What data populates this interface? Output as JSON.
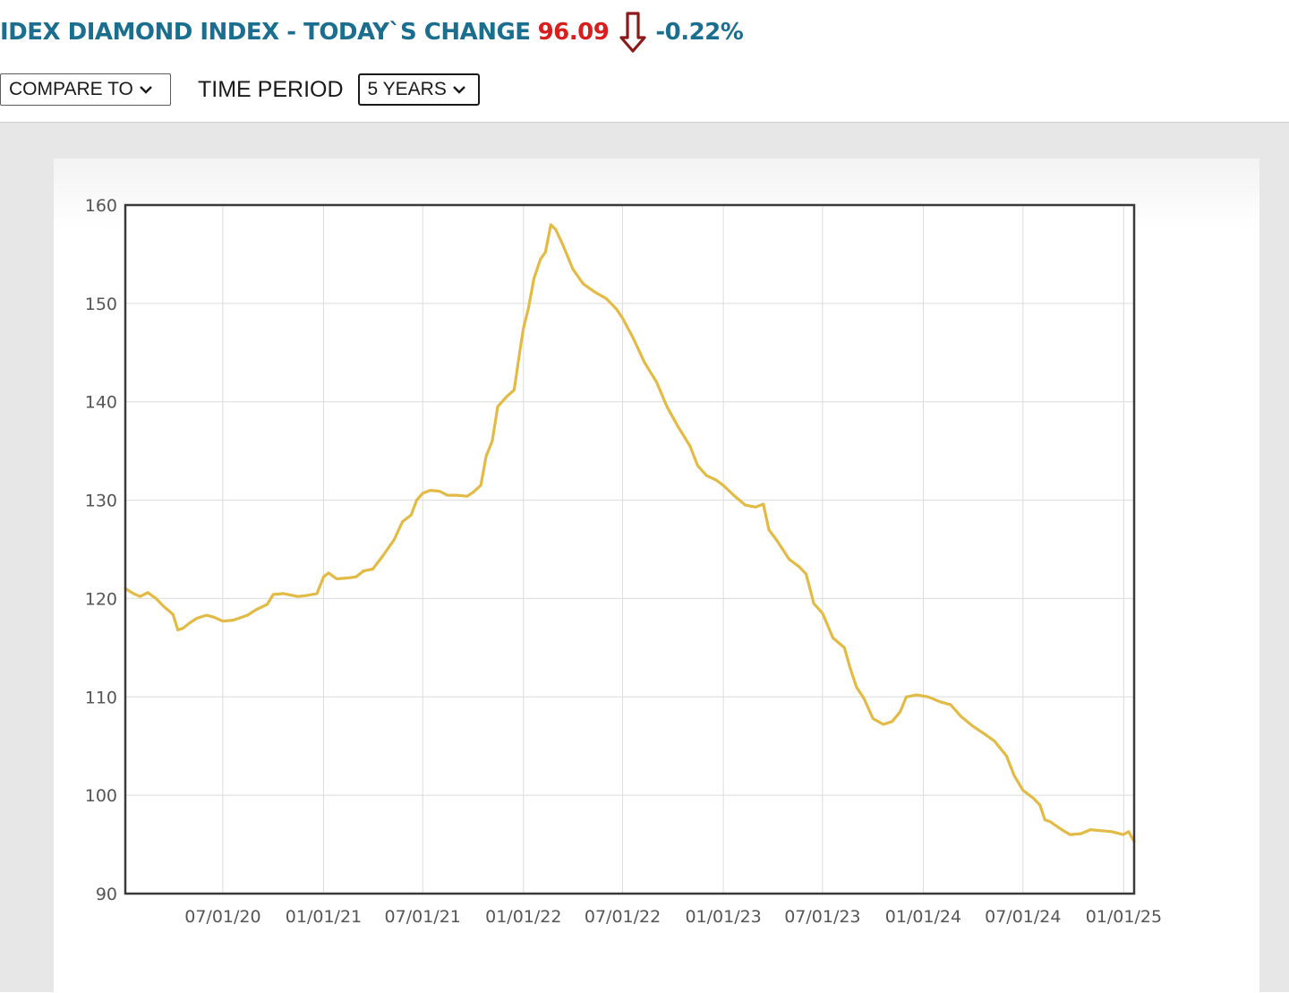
{
  "header": {
    "title": "IDEX DIAMOND INDEX - TODAY`S CHANGE",
    "value": "96.09",
    "change_pct": "-0.22%",
    "trend_icon": "arrow-down-icon",
    "colors": {
      "title": "#1c6e8e",
      "value": "#d81f1f",
      "arrow": "#8b1a1a"
    }
  },
  "controls": {
    "compare_label": "COMPARE TO",
    "period_label": "TIME PERIOD",
    "period_value": "5 YEARS"
  },
  "chart_data": {
    "type": "line",
    "title": "",
    "xlabel": "",
    "ylabel": "",
    "ylim": [
      90,
      160
    ],
    "xlim": [
      "2020-01-05",
      "2025-01-20"
    ],
    "yticks": [
      90,
      100,
      110,
      120,
      130,
      140,
      150,
      160
    ],
    "xticks": [
      "07/01/20",
      "01/01/21",
      "07/01/21",
      "01/01/22",
      "07/01/22",
      "01/01/23",
      "07/01/23",
      "01/01/24",
      "07/01/24",
      "01/01/25"
    ],
    "xtick_dates": [
      "2020-07-01",
      "2021-01-01",
      "2021-07-01",
      "2022-01-01",
      "2022-07-01",
      "2023-01-01",
      "2023-07-01",
      "2024-01-01",
      "2024-07-01",
      "2025-01-01"
    ],
    "grid": true,
    "legend": "none",
    "line_color": "#e2bb47",
    "series": [
      {
        "name": "",
        "points": [
          [
            "2020-01-05",
            121.0
          ],
          [
            "2020-01-20",
            120.5
          ],
          [
            "2020-02-01",
            120.2
          ],
          [
            "2020-02-15",
            120.6
          ],
          [
            "2020-03-01",
            120.0
          ],
          [
            "2020-03-15",
            119.2
          ],
          [
            "2020-04-01",
            118.4
          ],
          [
            "2020-04-10",
            116.8
          ],
          [
            "2020-04-20",
            117.0
          ],
          [
            "2020-05-01",
            117.5
          ],
          [
            "2020-05-15",
            118.0
          ],
          [
            "2020-06-01",
            118.3
          ],
          [
            "2020-06-15",
            118.1
          ],
          [
            "2020-07-01",
            117.7
          ],
          [
            "2020-07-20",
            117.8
          ],
          [
            "2020-08-15",
            118.3
          ],
          [
            "2020-09-01",
            118.9
          ],
          [
            "2020-09-20",
            119.4
          ],
          [
            "2020-10-01",
            120.4
          ],
          [
            "2020-10-20",
            120.5
          ],
          [
            "2020-11-15",
            120.2
          ],
          [
            "2020-12-01",
            120.3
          ],
          [
            "2020-12-20",
            120.5
          ],
          [
            "2021-01-01",
            122.2
          ],
          [
            "2021-01-10",
            122.6
          ],
          [
            "2021-01-25",
            122.0
          ],
          [
            "2021-02-15",
            122.1
          ],
          [
            "2021-03-01",
            122.2
          ],
          [
            "2021-03-15",
            122.8
          ],
          [
            "2021-04-01",
            123.0
          ],
          [
            "2021-04-20",
            124.4
          ],
          [
            "2021-05-10",
            126.0
          ],
          [
            "2021-05-25",
            127.8
          ],
          [
            "2021-06-10",
            128.5
          ],
          [
            "2021-06-20",
            130.0
          ],
          [
            "2021-07-01",
            130.7
          ],
          [
            "2021-07-15",
            131.0
          ],
          [
            "2021-08-01",
            130.9
          ],
          [
            "2021-08-15",
            130.5
          ],
          [
            "2021-09-01",
            130.5
          ],
          [
            "2021-09-20",
            130.4
          ],
          [
            "2021-10-01",
            130.8
          ],
          [
            "2021-10-15",
            131.5
          ],
          [
            "2021-10-25",
            134.5
          ],
          [
            "2021-11-05",
            136.0
          ],
          [
            "2021-11-15",
            139.5
          ],
          [
            "2021-12-01",
            140.5
          ],
          [
            "2021-12-15",
            141.2
          ],
          [
            "2021-12-25",
            145.0
          ],
          [
            "2022-01-01",
            147.5
          ],
          [
            "2022-01-10",
            149.5
          ],
          [
            "2022-01-20",
            152.5
          ],
          [
            "2022-02-01",
            154.5
          ],
          [
            "2022-02-10",
            155.2
          ],
          [
            "2022-02-20",
            158.0
          ],
          [
            "2022-03-01",
            157.5
          ],
          [
            "2022-03-15",
            155.8
          ],
          [
            "2022-04-01",
            153.5
          ],
          [
            "2022-04-20",
            152.0
          ],
          [
            "2022-05-10",
            151.2
          ],
          [
            "2022-06-01",
            150.5
          ],
          [
            "2022-06-20",
            149.4
          ],
          [
            "2022-07-01",
            148.5
          ],
          [
            "2022-07-20",
            146.5
          ],
          [
            "2022-08-10",
            144.0
          ],
          [
            "2022-09-01",
            142.0
          ],
          [
            "2022-09-20",
            139.5
          ],
          [
            "2022-10-10",
            137.5
          ],
          [
            "2022-11-01",
            135.5
          ],
          [
            "2022-11-15",
            133.5
          ],
          [
            "2022-12-01",
            132.5
          ],
          [
            "2022-12-20",
            132.0
          ],
          [
            "2023-01-01",
            131.5
          ],
          [
            "2023-01-20",
            130.5
          ],
          [
            "2023-02-10",
            129.5
          ],
          [
            "2023-03-01",
            129.3
          ],
          [
            "2023-03-15",
            129.6
          ],
          [
            "2023-03-25",
            127.0
          ],
          [
            "2023-04-10",
            125.8
          ],
          [
            "2023-05-01",
            124.0
          ],
          [
            "2023-05-20",
            123.2
          ],
          [
            "2023-06-01",
            122.5
          ],
          [
            "2023-06-15",
            119.5
          ],
          [
            "2023-07-01",
            118.5
          ],
          [
            "2023-07-20",
            116.0
          ],
          [
            "2023-08-10",
            115.0
          ],
          [
            "2023-08-20",
            113.0
          ],
          [
            "2023-09-01",
            111.0
          ],
          [
            "2023-09-15",
            109.8
          ],
          [
            "2023-10-01",
            107.8
          ],
          [
            "2023-10-20",
            107.2
          ],
          [
            "2023-11-05",
            107.5
          ],
          [
            "2023-11-20",
            108.5
          ],
          [
            "2023-12-01",
            110.0
          ],
          [
            "2023-12-20",
            110.2
          ],
          [
            "2024-01-10",
            110.0
          ],
          [
            "2024-02-01",
            109.5
          ],
          [
            "2024-02-20",
            109.2
          ],
          [
            "2024-03-10",
            108.0
          ],
          [
            "2024-04-01",
            107.0
          ],
          [
            "2024-04-20",
            106.3
          ],
          [
            "2024-05-10",
            105.5
          ],
          [
            "2024-06-01",
            104.0
          ],
          [
            "2024-06-15",
            102.0
          ],
          [
            "2024-07-01",
            100.5
          ],
          [
            "2024-07-20",
            99.7
          ],
          [
            "2024-08-01",
            99.0
          ],
          [
            "2024-08-10",
            97.5
          ],
          [
            "2024-08-20",
            97.3
          ],
          [
            "2024-09-10",
            96.5
          ],
          [
            "2024-09-25",
            96.0
          ],
          [
            "2024-10-15",
            96.1
          ],
          [
            "2024-11-01",
            96.5
          ],
          [
            "2024-11-20",
            96.4
          ],
          [
            "2024-12-10",
            96.3
          ],
          [
            "2024-12-31",
            96.0
          ],
          [
            "2025-01-10",
            96.3
          ],
          [
            "2025-01-20",
            95.3
          ]
        ]
      }
    ]
  }
}
